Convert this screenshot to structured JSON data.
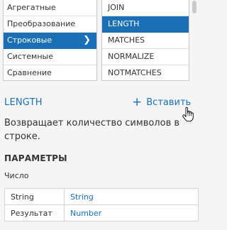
{
  "categories": {
    "items": [
      {
        "label": "Агрегатные",
        "selected": false
      },
      {
        "label": "Преобразование",
        "selected": false
      },
      {
        "label": "Строковые",
        "selected": true
      },
      {
        "label": "Системные",
        "selected": false
      },
      {
        "label": "Сравнение",
        "selected": false
      }
    ],
    "selected_chevron": "chevron-right-icon"
  },
  "functions": {
    "items": [
      {
        "label": "JOIN",
        "selected": false
      },
      {
        "label": "LENGTH",
        "selected": true
      },
      {
        "label": "MATCHES",
        "selected": false
      },
      {
        "label": "NORMALIZE",
        "selected": false
      },
      {
        "label": "NOTMATCHES",
        "selected": false
      }
    ]
  },
  "detail": {
    "title": "LENGTH",
    "insert_label": "Вставить",
    "insert_icon": "plus-icon",
    "description": "Возвращает количество символов в строке.",
    "params_heading": "ПАРАМЕТРЫ",
    "params_subheading": "Число",
    "params": [
      {
        "name": "String",
        "type": "String"
      },
      {
        "name": "Результат",
        "type": "Number"
      }
    ]
  },
  "colors": {
    "accent": "#1b6fb4",
    "background": "#f5f5f5",
    "list_background": "#ffffff",
    "border": "#c8c8c8",
    "text": "#333333"
  }
}
